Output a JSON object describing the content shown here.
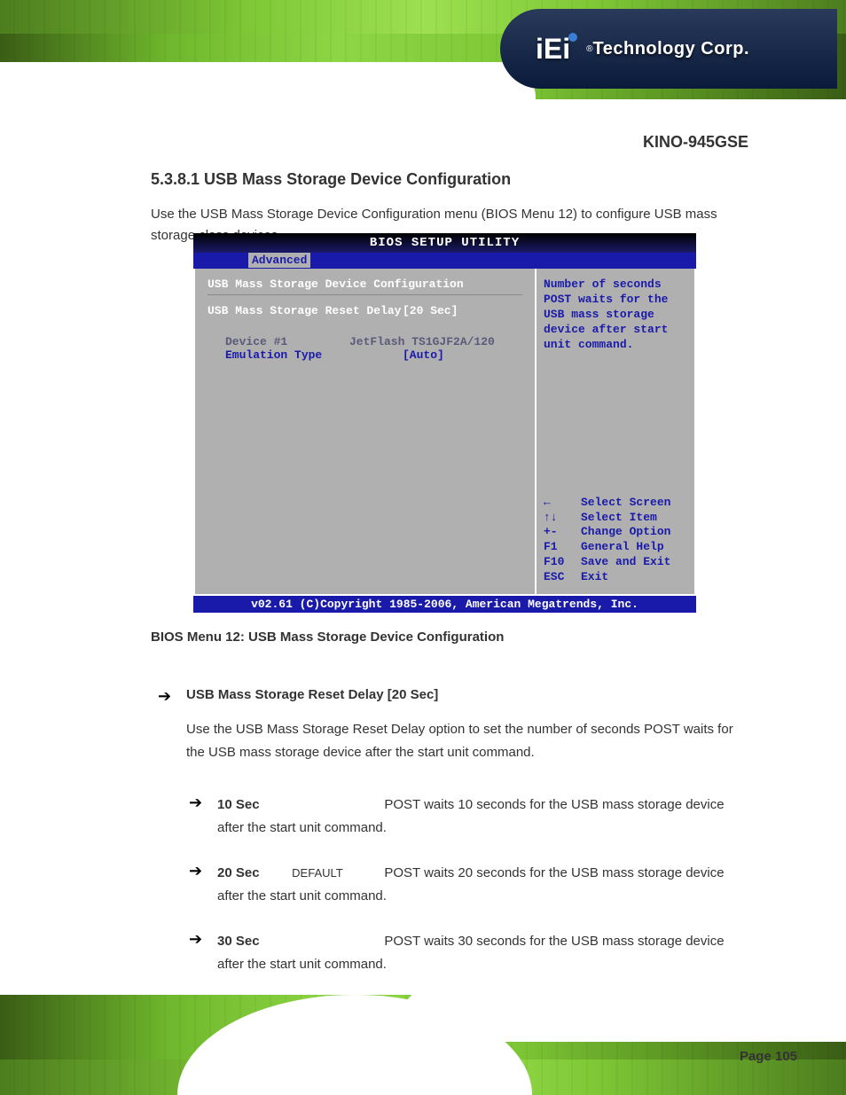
{
  "logo": {
    "brand": "iEi",
    "reg": "®",
    "tagline": "Technology Corp."
  },
  "product_name": "KINO-945GSE",
  "main_heading": "5.3.8.1 USB Mass Storage Device Configuration",
  "intro_text": "Use the USB Mass Storage Device Configuration menu (BIOS Menu 12) to configure USB mass storage class devices.",
  "bios": {
    "title": "BIOS SETUP UTILITY",
    "tab": "Advanced",
    "section_title": "USB Mass Storage Device Configuration",
    "reset_delay_label": "USB Mass Storage Reset Delay",
    "reset_delay_value": "[20 Sec]",
    "device_label": "Device #1",
    "device_value": "JetFlash TS1GJF2A/120",
    "emulation_label": "Emulation Type",
    "emulation_value": "[Auto]",
    "help_text": "Number of seconds POST waits for the USB mass storage device after start unit command.",
    "nav": [
      {
        "key": "←",
        "label": "Select Screen"
      },
      {
        "key": "↑↓",
        "label": "Select Item"
      },
      {
        "key": "+-",
        "label": "Change Option"
      },
      {
        "key": "F1",
        "label": "General Help"
      },
      {
        "key": "F10",
        "label": "Save and Exit"
      },
      {
        "key": "ESC",
        "label": "Exit"
      }
    ],
    "footer": "v02.61 (C)Copyright 1985-2006, American Megatrends, Inc."
  },
  "figure_caption": "BIOS Menu 12: USB Mass Storage Device Configuration",
  "option1": {
    "title": "USB Mass Storage Reset Delay [20 Sec]",
    "desc": "Use the USB Mass Storage Reset Delay option to set the number of seconds POST waits for the USB mass storage device after the start unit command."
  },
  "suboptions": [
    {
      "key": "10 Sec",
      "default": "",
      "desc": "POST waits 10 seconds for the USB mass storage device after the start unit command."
    },
    {
      "key": "20 Sec",
      "default": "DEFAULT",
      "desc": "POST waits 20 seconds for the USB mass storage device after the start unit command."
    },
    {
      "key": "30 Sec",
      "default": "",
      "desc": "POST waits 30 seconds for the USB mass storage device after the start unit command."
    }
  ],
  "page": {
    "label": "Page 105",
    "num": ""
  }
}
